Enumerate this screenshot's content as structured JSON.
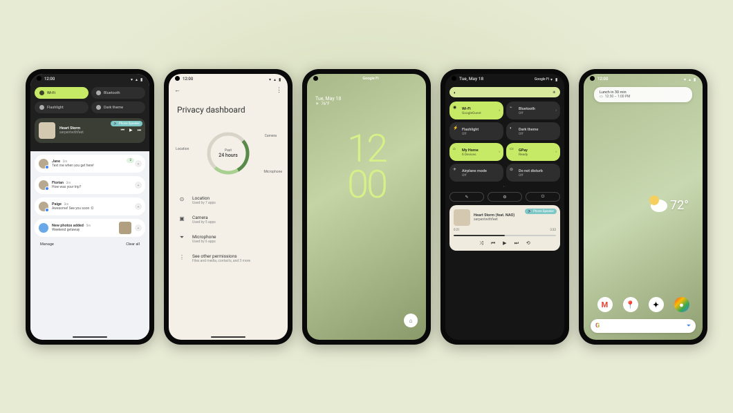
{
  "phone1": {
    "time": "12:00",
    "qs": {
      "wifi": "Wi-Fi",
      "bluetooth": "Bluetooth",
      "flashlight": "Flashlight",
      "dark": "Dark theme"
    },
    "media": {
      "title": "Heart Storm",
      "subtitle": "serpentwithfeet",
      "speaker": "Phone Speaker"
    },
    "notifications": [
      {
        "name": "Jane",
        "age": "2m",
        "body": "Text me when you get here!",
        "badge": "2"
      },
      {
        "name": "Florian",
        "age": "2m",
        "body": "How was your trip?"
      },
      {
        "name": "Paige",
        "age": "2m",
        "body": "Awesome! See you soon :O"
      },
      {
        "name": "New photos added",
        "age": "5m",
        "body": "Weekend getaway"
      }
    ],
    "footer": {
      "manage": "Manage",
      "clear": "Clear all"
    }
  },
  "phone2": {
    "time": "12:00",
    "title": "Privacy dashboard",
    "donut": {
      "center_top": "Past",
      "center_main": "24 hours",
      "loc": "Location",
      "cam": "Camera",
      "mic": "Microphone"
    },
    "perms": [
      {
        "icon": "⊙",
        "title": "Location",
        "sub": "Used by 7 apps"
      },
      {
        "icon": "▣",
        "title": "Camera",
        "sub": "Used by 5 apps"
      },
      {
        "icon": "⏷",
        "title": "Microphone",
        "sub": "Used by 6 apps"
      },
      {
        "icon": "⋮",
        "title": "See other permissions",
        "sub": "Files and media, contacts, and 3 more"
      }
    ]
  },
  "phone3": {
    "carrier": "Google Fi",
    "date": "Tue, May 18",
    "temp": "76°F",
    "clock_h": "12",
    "clock_m": "00"
  },
  "phone4": {
    "date": "Tue, May 18",
    "carrier": "Google Fi",
    "tiles": {
      "wifi": {
        "t": "Wi-Fi",
        "s": "GoogleGuest"
      },
      "bt": {
        "t": "Bluetooth",
        "s": "Off"
      },
      "flash": {
        "t": "Flashlight",
        "s": "Off"
      },
      "dark": {
        "t": "Dark theme",
        "s": "Off"
      },
      "home": {
        "t": "My Home",
        "s": "6 Devices"
      },
      "gpay": {
        "t": "GPay",
        "s": "Ready"
      },
      "air": {
        "t": "Airplane mode",
        "s": "Off"
      },
      "dnd": {
        "t": "Do not disturb",
        "s": "Off"
      }
    },
    "media": {
      "title": "Heart Storm (feat. NAO)",
      "subtitle": "serpentwithfeet",
      "speaker": "Phone Speaker",
      "elapsed": "0:21",
      "total": "3:32"
    }
  },
  "phone5": {
    "time": "12:00",
    "event": {
      "title": "Lunch in 30 min",
      "time": "12:30 – 1:00 PM"
    },
    "weather": "72°",
    "apps": [
      "M",
      "📍",
      "✦",
      "●"
    ]
  }
}
